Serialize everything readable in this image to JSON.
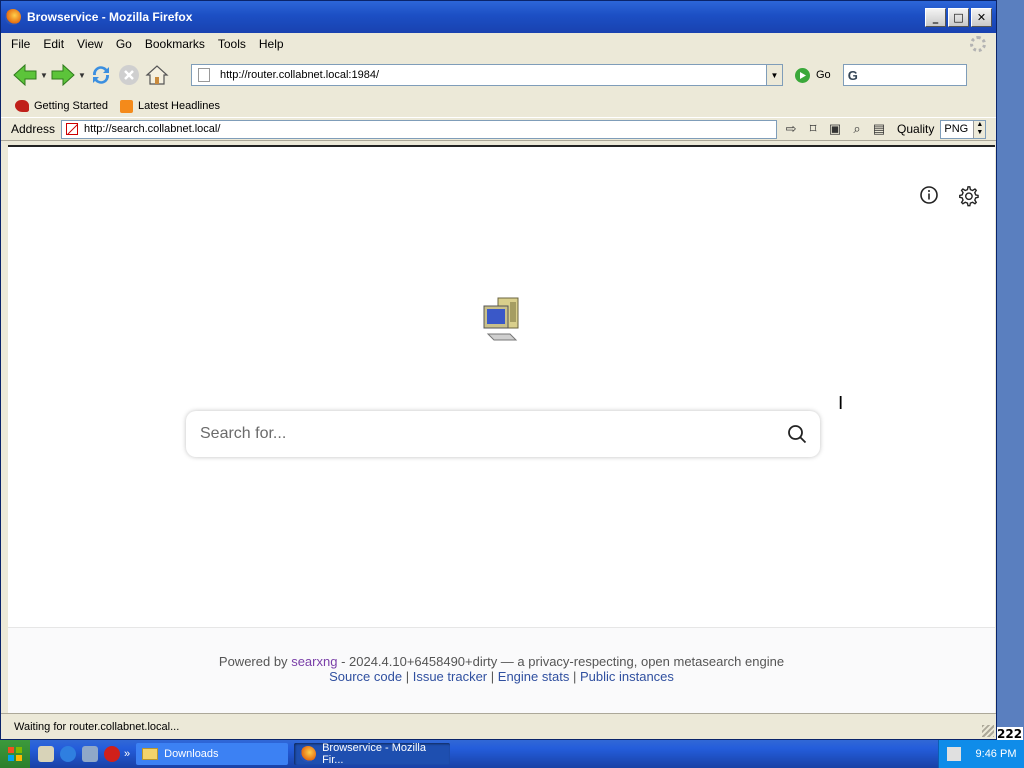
{
  "window": {
    "title": "Browservice - Mozilla Firefox",
    "controls": {
      "minimize": "_",
      "maximize": "□",
      "close": "✕"
    }
  },
  "menu": [
    "File",
    "Edit",
    "View",
    "Go",
    "Bookmarks",
    "Tools",
    "Help"
  ],
  "navbar": {
    "url": "http://router.collabnet.local:1984/",
    "go_label": "Go",
    "search_engine_glyph": "G"
  },
  "bookmarks": [
    {
      "label": "Getting Started",
      "icon": "getting-started-icon"
    },
    {
      "label": "Latest Headlines",
      "icon": "rss-icon"
    }
  ],
  "addressbar": {
    "label": "Address",
    "url": "http://search.collabnet.local/",
    "quality_label": "Quality",
    "quality_value": "PNG"
  },
  "page": {
    "search_placeholder": "Search for...",
    "footer": {
      "powered_by": "Powered by",
      "engine_link": "searxng",
      "version_text": "- 2024.4.10+6458490+dirty — a privacy-respecting, open metasearch engine",
      "links": [
        "Source code",
        "Issue tracker",
        "Engine stats",
        "Public instances"
      ],
      "separator": "|"
    }
  },
  "status": "Waiting for router.collabnet.local...",
  "taskbar": {
    "tasks": [
      "Downloads",
      "Browservice - Mozilla Fir..."
    ],
    "clock": "9:46 PM",
    "chevron": "»"
  },
  "desktop_badge": "222",
  "colors": {
    "titlebar": "#1c4fc4",
    "link_purple": "#7a3fa8",
    "link_blue": "#3050a0",
    "taskbar": "#245ddb"
  }
}
